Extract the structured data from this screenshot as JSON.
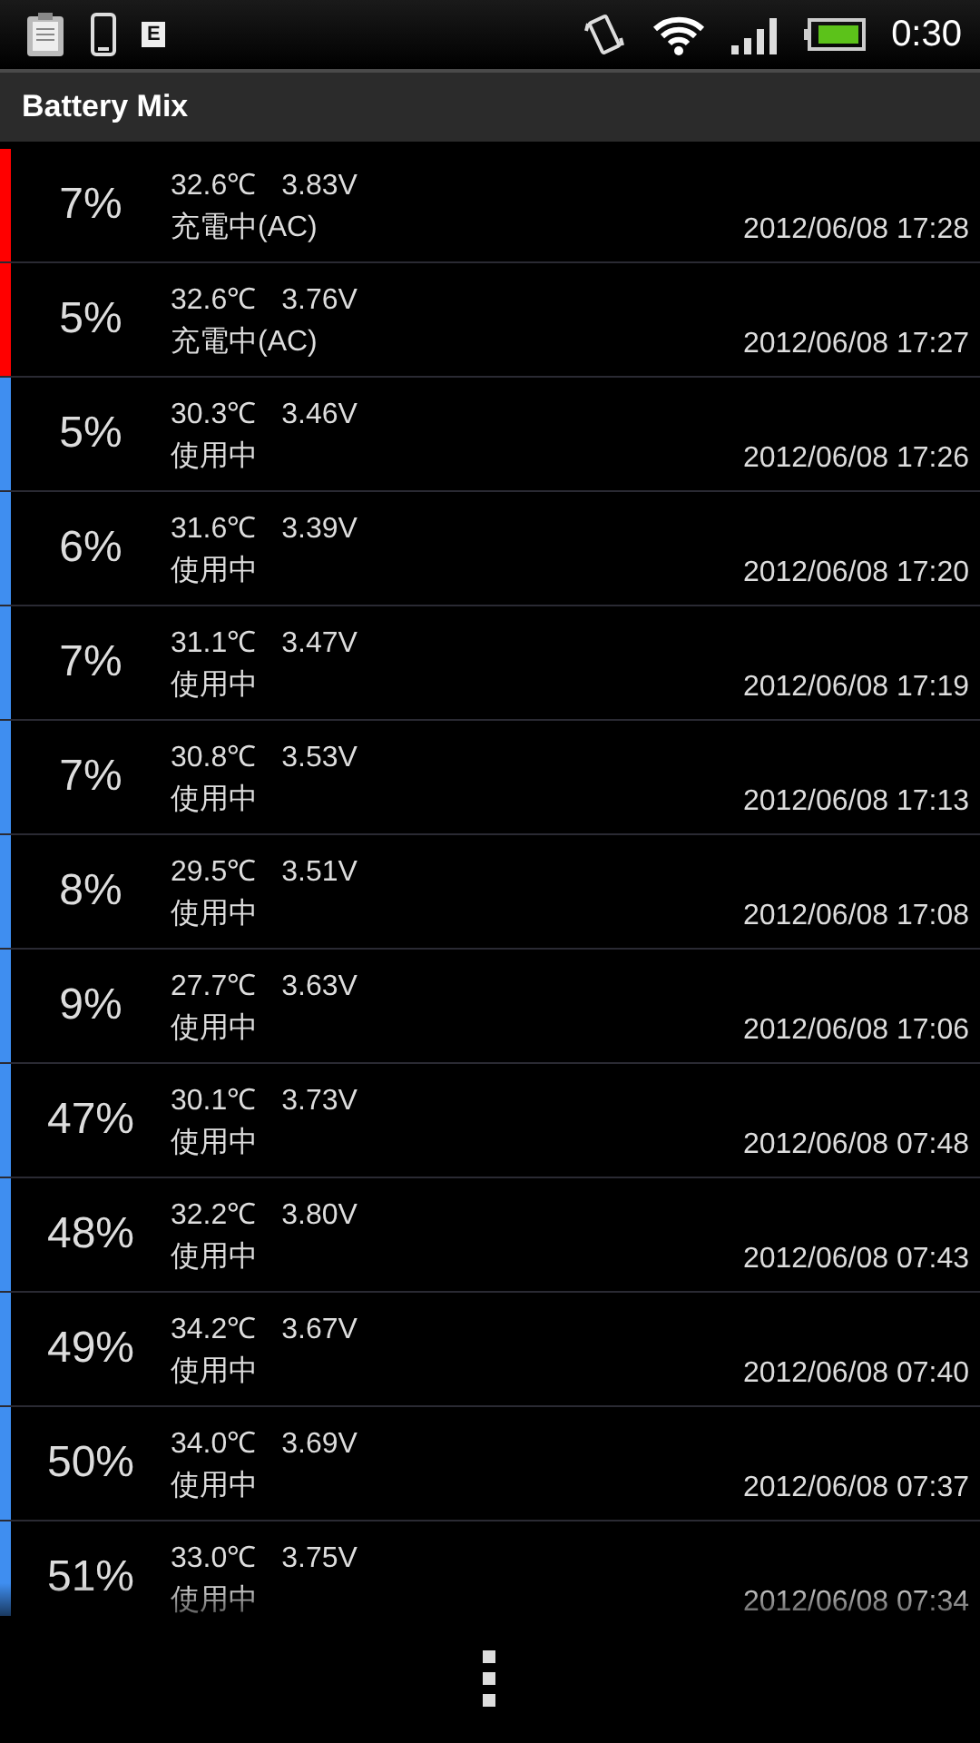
{
  "status_bar": {
    "badge": "E",
    "time": "0:30"
  },
  "title": "Battery Mix",
  "records": [
    {
      "percent": "7%",
      "temperature": "32.6℃",
      "voltage": "3.83V",
      "state": "充電中(AC)",
      "time": "2012/06/08 17:28",
      "color": "#ff0000"
    },
    {
      "percent": "5%",
      "temperature": "32.6℃",
      "voltage": "3.76V",
      "state": "充電中(AC)",
      "time": "2012/06/08 17:27",
      "color": "#ff0000"
    },
    {
      "percent": "5%",
      "temperature": "30.3℃",
      "voltage": "3.46V",
      "state": "使用中",
      "time": "2012/06/08 17:26",
      "color": "#3f8ef0"
    },
    {
      "percent": "6%",
      "temperature": "31.6℃",
      "voltage": "3.39V",
      "state": "使用中",
      "time": "2012/06/08 17:20",
      "color": "#3f8ef0"
    },
    {
      "percent": "7%",
      "temperature": "31.1℃",
      "voltage": "3.47V",
      "state": "使用中",
      "time": "2012/06/08 17:19",
      "color": "#3f8ef0"
    },
    {
      "percent": "7%",
      "temperature": "30.8℃",
      "voltage": "3.53V",
      "state": "使用中",
      "time": "2012/06/08 17:13",
      "color": "#3f8ef0"
    },
    {
      "percent": "8%",
      "temperature": "29.5℃",
      "voltage": "3.51V",
      "state": "使用中",
      "time": "2012/06/08 17:08",
      "color": "#3f8ef0"
    },
    {
      "percent": "9%",
      "temperature": "27.7℃",
      "voltage": "3.63V",
      "state": "使用中",
      "time": "2012/06/08 17:06",
      "color": "#3f8ef0"
    },
    {
      "percent": "47%",
      "temperature": "30.1℃",
      "voltage": "3.73V",
      "state": "使用中",
      "time": "2012/06/08 07:48",
      "color": "#3f8ef0"
    },
    {
      "percent": "48%",
      "temperature": "32.2℃",
      "voltage": "3.80V",
      "state": "使用中",
      "time": "2012/06/08 07:43",
      "color": "#3f8ef0"
    },
    {
      "percent": "49%",
      "temperature": "34.2℃",
      "voltage": "3.67V",
      "state": "使用中",
      "time": "2012/06/08 07:40",
      "color": "#3f8ef0"
    },
    {
      "percent": "50%",
      "temperature": "34.0℃",
      "voltage": "3.69V",
      "state": "使用中",
      "time": "2012/06/08 07:37",
      "color": "#3f8ef0"
    },
    {
      "percent": "51%",
      "temperature": "33.0℃",
      "voltage": "3.75V",
      "state": "使用中",
      "time": "2012/06/08 07:34",
      "color": "#3f8ef0"
    }
  ]
}
